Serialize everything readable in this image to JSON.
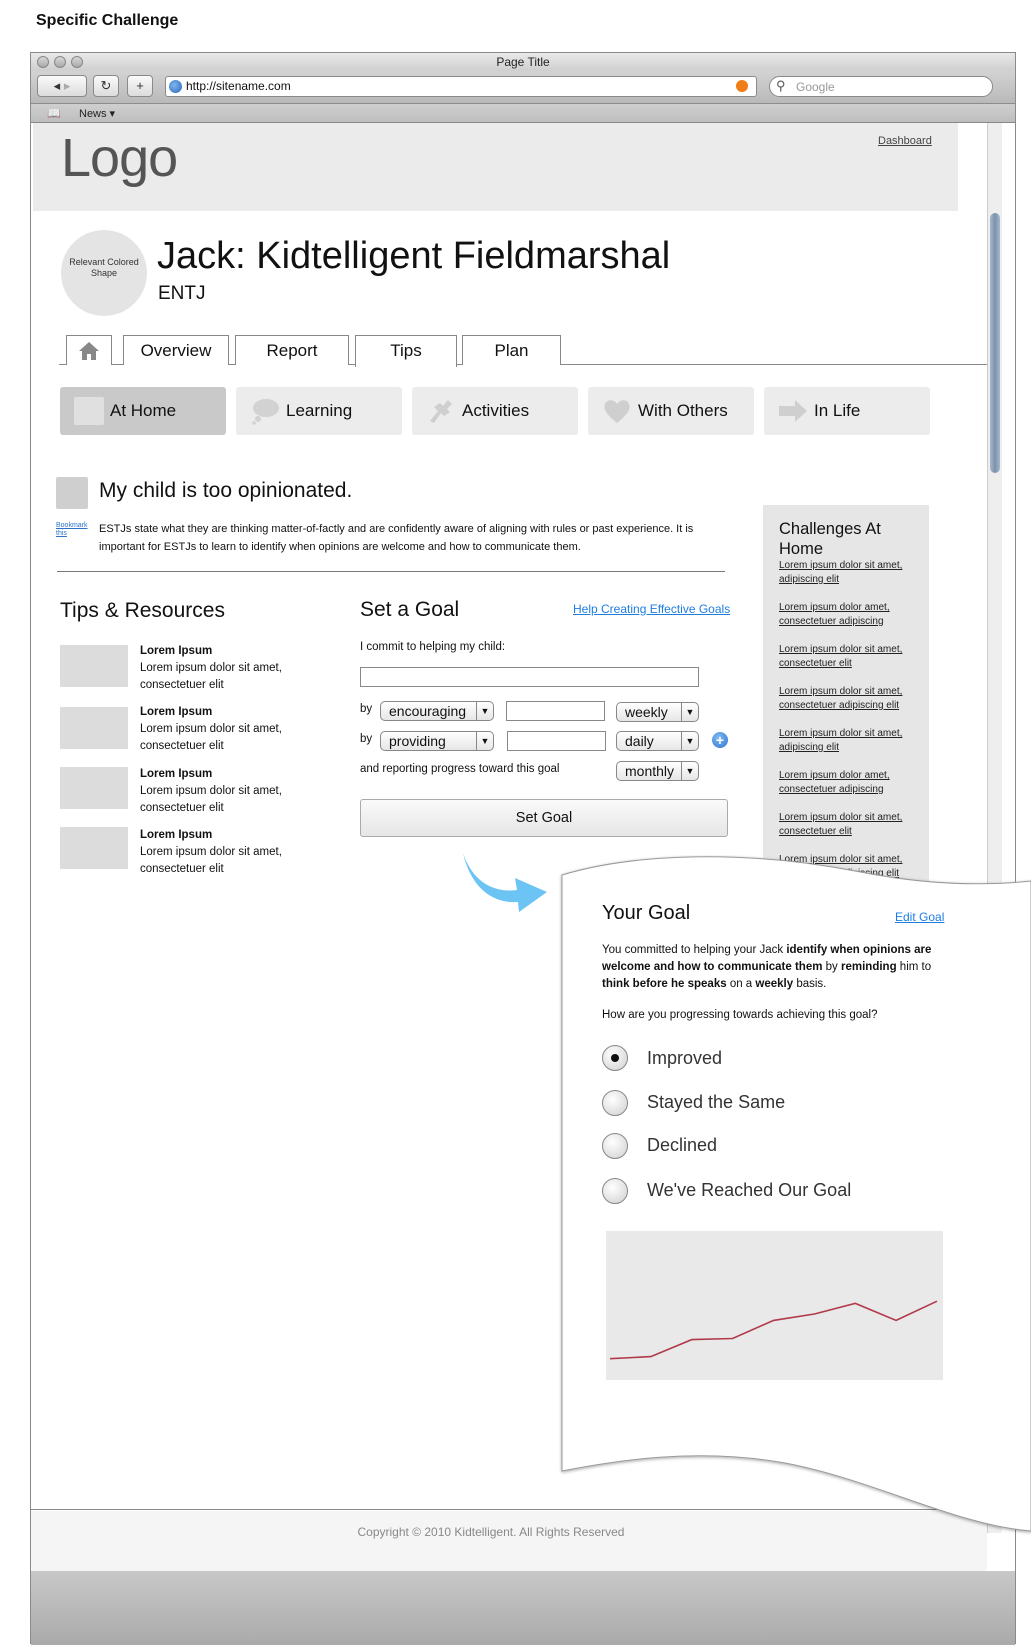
{
  "caption": "Specific Challenge",
  "browser": {
    "title": "Page Title",
    "url": "http://sitename.com",
    "search_placeholder": "Google",
    "bookmarks": [
      "News ▾"
    ]
  },
  "header": {
    "logo": "Logo",
    "dashboard_link": "Dashboard"
  },
  "profile": {
    "avatar_text": "Relevant Colored Shape",
    "name": "Jack: Kidtelligent Fieldmarshal",
    "type": "ENTJ"
  },
  "tabs": [
    {
      "label": "Overview"
    },
    {
      "label": "Report"
    },
    {
      "label": "Tips",
      "active": true
    },
    {
      "label": "Plan"
    }
  ],
  "subnav": [
    {
      "label": "At Home",
      "icon": "square-icon",
      "active": true
    },
    {
      "label": "Learning",
      "icon": "thought-bubble-icon"
    },
    {
      "label": "Activities",
      "icon": "puzzle-piece-icon"
    },
    {
      "label": "With Others",
      "icon": "heart-icon"
    },
    {
      "label": "In Life",
      "icon": "arrow-right-icon"
    }
  ],
  "challenge": {
    "title": "My child is too opinionated.",
    "bookmark": "Bookmark this",
    "description": "ESTJs state what they are thinking matter-of-factly and are confidently aware of aligning with rules or past experience. It is important for ESTJs to learn to identify when opinions are welcome and how to communicate them."
  },
  "tips": {
    "title": "Tips & Resources",
    "items": [
      {
        "heading": "Lorem Ipsum",
        "body": "Lorem ipsum dolor sit amet, consectetuer elit"
      },
      {
        "heading": "Lorem Ipsum",
        "body": "Lorem ipsum dolor sit amet, consectetuer elit"
      },
      {
        "heading": "Lorem Ipsum",
        "body": "Lorem ipsum dolor sit amet, consectetuer elit"
      },
      {
        "heading": "Lorem Ipsum",
        "body": "Lorem ipsum dolor sit amet, consectetuer elit"
      }
    ]
  },
  "set_goal": {
    "title": "Set a Goal",
    "help_link": "Help Creating Effective Goals",
    "commit_label": "I commit to helping my child:",
    "by": "by",
    "row1": {
      "method": "encouraging",
      "frequency": "weekly"
    },
    "row2": {
      "method": "providing",
      "frequency": "daily"
    },
    "reporting_label": "and reporting progress toward this goal",
    "reporting_frequency": "monthly",
    "button": "Set Goal"
  },
  "sidebar": {
    "title": "Challenges At Home",
    "links": [
      "Lorem ipsum dolor sit amet, adipiscing elit",
      "Lorem ipsum dolor amet, consectetuer adipiscing",
      "Lorem ipsum dolor sit amet, consectetuer elit",
      "Lorem ipsum dolor sit amet, consectetuer adipiscing elit",
      "Lorem ipsum dolor sit amet, adipiscing elit",
      "Lorem ipsum dolor amet, consectetuer adipiscing",
      "Lorem ipsum dolor sit amet, consectetuer elit",
      "Lorem ipsum dolor sit amet, consectetuer adipiscing elit"
    ]
  },
  "your_goal": {
    "title": "Your Goal",
    "edit_link": "Edit Goal",
    "t1": "You committed to helping your Jack ",
    "b1": "identify when opinions are welcome and how to communicate them",
    "t2": " by ",
    "b2": "reminding",
    "t3": " him to ",
    "b3": "think before he speaks",
    "t4": " on a ",
    "b4": "weekly",
    "t5": " basis.",
    "question": "How are you progressing towards achieving this goal?",
    "options": [
      {
        "label": "Improved",
        "checked": true
      },
      {
        "label": "Stayed the Same",
        "checked": false
      },
      {
        "label": "Declined",
        "checked": false
      },
      {
        "label": "We've Reached Our Goal",
        "checked": false
      }
    ]
  },
  "chart_data": {
    "type": "line",
    "x": [
      1,
      2,
      3,
      4,
      5,
      6,
      7,
      8,
      9
    ],
    "series": [
      {
        "values": [
          10,
          11,
          19,
          19.5,
          28,
          31,
          36,
          28,
          37
        ]
      }
    ],
    "ylim": [
      0,
      70
    ],
    "color": "#b03a4a",
    "grid": false
  },
  "footer": {
    "copyright": "Copyright © 2010 Kidtelligent. All Rights Reserved"
  },
  "colors": {
    "link": "#1e7ee0",
    "arrow": "#6cc4f4",
    "line": "#b03a4a"
  }
}
